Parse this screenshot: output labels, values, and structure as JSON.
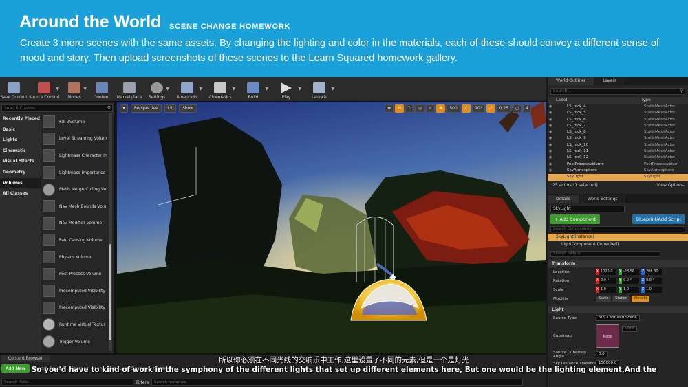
{
  "banner": {
    "title": "Around the World",
    "subtitle": "SCENE CHANGE HOMEWORK",
    "description": "Create 3 more scenes with the same assets. By changing the lighting and color in the materials, each of these should convey a different sense of mood and story. Then upload screenshots of these scenes to the Learn Squared homework gallery."
  },
  "toolbar": {
    "buttons": [
      "Save Current",
      "Source Control",
      "Modes",
      "Content",
      "Marketplace",
      "Settings",
      "Blueprints",
      "Cinematics",
      "Build",
      "Play",
      "Launch"
    ]
  },
  "place": {
    "search_placeholder": "Search Classes",
    "categories": [
      "Recently Placed",
      "Basic",
      "Lights",
      "Cinematic",
      "Visual Effects",
      "Geometry",
      "Volumes",
      "All Classes"
    ],
    "items": [
      "Kill ZVolume",
      "Level Streaming Volum",
      "Lightmass Character In",
      "Lightmass Importance",
      "Mesh Merge Culling Vo",
      "Nav Mesh Bounds Volu",
      "Nav Modifier Volume",
      "Pain Causing Volume",
      "Physics Volume",
      "Post Process Volume",
      "Precomputed Visibility",
      "Precomputed Visibility",
      "Runtime Virtual Textur",
      "Trigger Volume"
    ]
  },
  "viewport": {
    "perspective": "Perspective",
    "lit": "Lit",
    "show": "Show",
    "grid_value": "500",
    "angle_value": "10°",
    "scale_value": "0.25",
    "camera_speed": "4"
  },
  "outliner": {
    "tab1": "World Outliner",
    "tab2": "Layers",
    "search_placeholder": "Search...",
    "col_label": "Label",
    "col_type": "Type",
    "rows": [
      {
        "name": "LS_rock_4",
        "type": "StaticMeshActor"
      },
      {
        "name": "LS_rock_5",
        "type": "StaticMeshActor"
      },
      {
        "name": "LS_rock_6",
        "type": "StaticMeshActor"
      },
      {
        "name": "LS_rock_7",
        "type": "StaticMeshActor"
      },
      {
        "name": "LS_rock_8",
        "type": "StaticMeshActor"
      },
      {
        "name": "LS_rock_9",
        "type": "StaticMeshActor"
      },
      {
        "name": "LS_rock_10",
        "type": "StaticMeshActor"
      },
      {
        "name": "LS_rock_11",
        "type": "StaticMeshActor"
      },
      {
        "name": "LS_rock_12",
        "type": "StaticMeshActor"
      },
      {
        "name": "PostProcessVolume",
        "type": "PostProcessVolum"
      },
      {
        "name": "SkyAtmosphere",
        "type": "SkyAtmosphere"
      },
      {
        "name": "SkyLight",
        "type": "SkyLight"
      }
    ],
    "count": "25 actors (1 selected)",
    "view_options": "View Options"
  },
  "details": {
    "tab1": "Details",
    "tab2": "World Settings",
    "actor_name": "SkyLight",
    "add_component": "+ Add Component",
    "blueprint": "Blueprint/Add Script",
    "search_components": "Search Components",
    "instance": "SkyLight(Instance)",
    "component": "LightComponent (Inherited)",
    "search_details": "Search Details",
    "transform": "Transform",
    "location_label": "Location",
    "rotation_label": "Rotation",
    "scale_label": "Scale",
    "mobility_label": "Mobility",
    "location": [
      "1026.0",
      "-23.56",
      "206.30"
    ],
    "rotation": [
      "0.0 °",
      "0.0 °",
      "0.0 °"
    ],
    "scale": [
      "1.0",
      "1.0",
      "1.0"
    ],
    "mobility": [
      "Static",
      "Station",
      "Movabl"
    ],
    "light": "Light",
    "source_type_label": "Source Type",
    "source_type": "SLS Captured Scene",
    "cubemap_label": "Cubemap",
    "cubemap_none": "None",
    "cubemap_select": "None",
    "cubemap_angle_label": "Source Cubemap Angle",
    "cubemap_angle": "0.0",
    "sky_distance_label": "Sky Distance Threshol",
    "sky_distance": "150000.0"
  },
  "content_browser": {
    "tab": "Content Browser",
    "add_new": "Add New",
    "import": "Import",
    "save_all": "Save All",
    "path_content": "Content",
    "path_source": "SourceFiles",
    "path_ls": "LearnSquared",
    "path_mat": "materials",
    "filters": "Filters",
    "search_paths": "Search Paths",
    "search_materials": "Search materials"
  },
  "subtitles": {
    "cn": "所以你必须在不同光线的交响乐中工作,这里设置了不同的元素,但是一个是灯光",
    "en": "So you'd have to kind of work in the symphony of the different lights that set up different elements here, But one would be the lighting element,And the"
  }
}
